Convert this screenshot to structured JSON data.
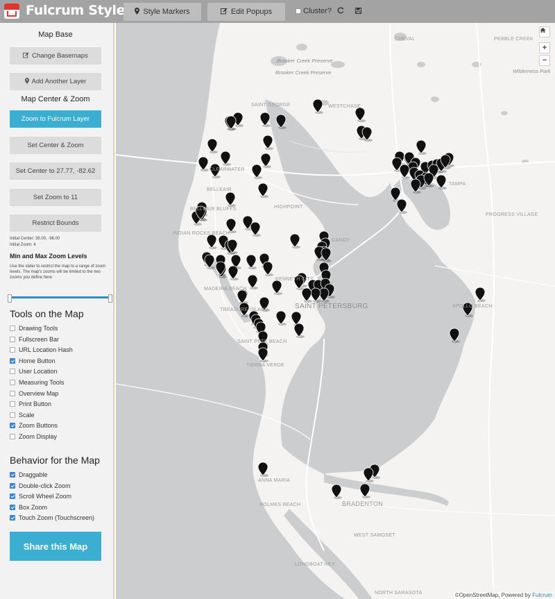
{
  "app": {
    "title": "Fulcrum Styler"
  },
  "toolbar": {
    "style_markers": "Style Markers",
    "edit_popups": "Edit Popups",
    "cluster_label": "Cluster?",
    "cluster_checked": false
  },
  "sidebar": {
    "map_base_title": "Map Base",
    "change_basemaps": "Change Basemaps",
    "add_layer": "Add Another Layer",
    "center_zoom_title": "Map Center & Zoom",
    "zoom_to_layer": "Zoom to Fulcrum Layer",
    "set_center_zoom": "Set Center & Zoom",
    "set_center_to": "Set Center to 27.77, -82.62",
    "set_zoom_to": "Set Zoom to 11",
    "restrict_bounds": "Restrict Bounds",
    "initial_center": "Initial Center: 39.00, -96.00",
    "initial_zoom": "Initial Zoom: 4",
    "zoom_levels_title": "Min and Max Zoom Levels",
    "zoom_levels_help": "Use the slider to restrict the map to a range of zoom levels. The map's zooms will be limited to the two zooms you define here:",
    "tools_title": "Tools on the Map",
    "tools": [
      {
        "label": "Drawing Tools",
        "checked": false
      },
      {
        "label": "Fullscreen Bar",
        "checked": false
      },
      {
        "label": "URL Location Hash",
        "checked": false
      },
      {
        "label": "Home Button",
        "checked": true
      },
      {
        "label": "User Location",
        "checked": false
      },
      {
        "label": "Measuring Tools",
        "checked": false
      },
      {
        "label": "Overview Map",
        "checked": false
      },
      {
        "label": "Print Button",
        "checked": false
      },
      {
        "label": "Scale",
        "checked": false
      },
      {
        "label": "Zoom Buttons",
        "checked": true
      },
      {
        "label": "Zoom Display",
        "checked": false
      }
    ],
    "behavior_title": "Behavior for the Map",
    "behaviors": [
      {
        "label": "Draggable",
        "checked": true
      },
      {
        "label": "Double-click Zoom",
        "checked": true
      },
      {
        "label": "Scroll Wheel Zoom",
        "checked": true
      },
      {
        "label": "Box Zoom",
        "checked": true
      },
      {
        "label": "Touch Zoom (Touchscreen)",
        "checked": true
      }
    ],
    "share": "Share this Map"
  },
  "map": {
    "zoom_in": "+",
    "zoom_out": "−",
    "attribution_osm": "©OpenStreetMap, Powered by",
    "attribution_fulcrum": "Fulcrum",
    "labels": {
      "brooker_creek_preserve_1": "Brooker Creek Preserve",
      "brooker_creek_preserve_2": "Brooker Creek Preserve",
      "wilderness_park": "Wilderness Park",
      "cheval": "CHEVAL",
      "pebble_creek": "PEBBLE CREEK",
      "saint_george": "SAINT GEORGE",
      "westchase": "WESTCHASE",
      "clearwater": "CLEARWATER",
      "belleair": "BELLEAIR",
      "belleair_bluffs": "BELLEAIR BLUFFS",
      "highpoint": "HIGHPOINT",
      "indian_rocks_beach": "INDIAN ROCKS BEACH",
      "tampa": "TAMPA",
      "progress_village": "PROGRESS VILLAGE",
      "gandy": "GANDY",
      "kenneth_city": "KENNETH CITY",
      "madeira_beach": "MADEIRA BEACH",
      "treasure_island": "TREASURE ISLAND",
      "saint_petersburg": "SAINT PETERSBURG",
      "saint_pete_beach": "SAINT PETE BEACH",
      "tierra_verde": "TIERRA VERDE",
      "apollo_beach": "APOLLO BEACH",
      "anna_maria": "ANNA MARIA",
      "bradenton": "BRADENTON",
      "holmes_beach": "HOLMES BEACH",
      "west_samoset": "WEST SAMOSET",
      "longboat_key": "LONGBOAT KEY",
      "north_sarasota": "NORTH SARASOTA"
    }
  },
  "colors": {
    "topbar": "#a3a3a3",
    "accent": "#3aafd2",
    "water": "#cbcdcf",
    "land": "#f4f3f1",
    "marker": "#111111"
  }
}
